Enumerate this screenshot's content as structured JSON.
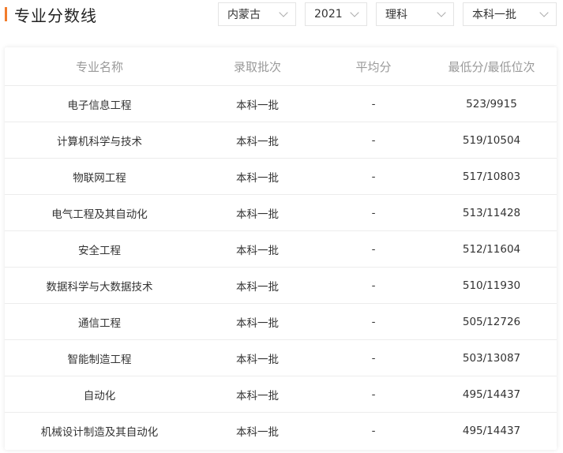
{
  "header": {
    "title": "专业分数线"
  },
  "filters": {
    "province": "内蒙古",
    "year": "2021",
    "subject": "理科",
    "batch": "本科一批"
  },
  "table": {
    "columns": [
      "专业名称",
      "录取批次",
      "平均分",
      "最低分/最低位次"
    ],
    "rows": [
      {
        "major": "电子信息工程",
        "batch": "本科一批",
        "avg": "-",
        "min": "523/9915"
      },
      {
        "major": "计算机科学与技术",
        "batch": "本科一批",
        "avg": "-",
        "min": "519/10504"
      },
      {
        "major": "物联网工程",
        "batch": "本科一批",
        "avg": "-",
        "min": "517/10803"
      },
      {
        "major": "电气工程及其自动化",
        "batch": "本科一批",
        "avg": "-",
        "min": "513/11428"
      },
      {
        "major": "安全工程",
        "batch": "本科一批",
        "avg": "-",
        "min": "512/11604"
      },
      {
        "major": "数据科学与大数据技术",
        "batch": "本科一批",
        "avg": "-",
        "min": "510/11930"
      },
      {
        "major": "通信工程",
        "batch": "本科一批",
        "avg": "-",
        "min": "505/12726"
      },
      {
        "major": "智能制造工程",
        "batch": "本科一批",
        "avg": "-",
        "min": "503/13087"
      },
      {
        "major": "自动化",
        "batch": "本科一批",
        "avg": "-",
        "min": "495/14437"
      },
      {
        "major": "机械设计制造及其自动化",
        "batch": "本科一批",
        "avg": "-",
        "min": "495/14437"
      }
    ]
  }
}
